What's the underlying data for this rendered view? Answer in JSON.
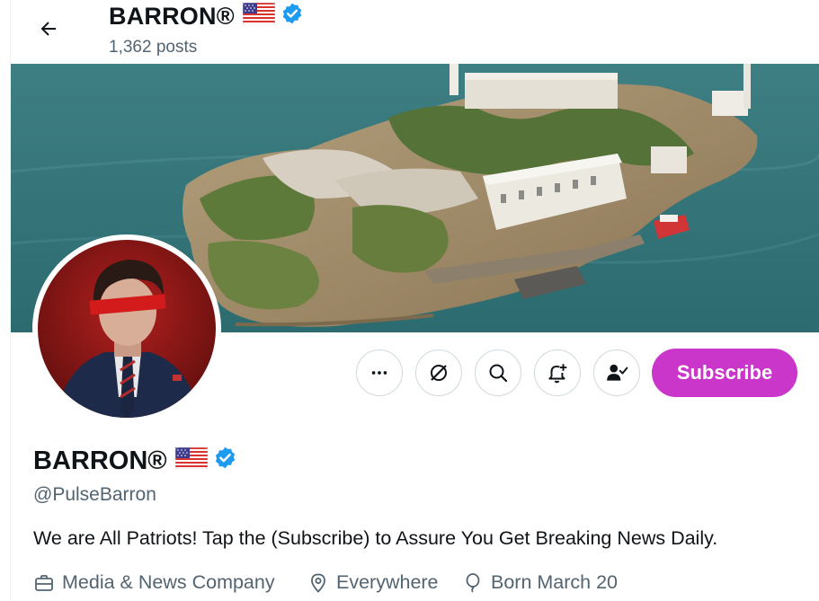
{
  "header": {
    "name": "BARRON®",
    "posts": "1,362 posts"
  },
  "actions": {
    "subscribe_label": "Subscribe",
    "icons": [
      "more-icon",
      "grok-icon",
      "search-icon",
      "notification-add-icon",
      "following-icon"
    ]
  },
  "profile": {
    "name": "BARRON®",
    "handle": "@PulseBarron",
    "bio": "We are All Patriots! Tap the (Subscribe) to Assure You Get Breaking News Daily.",
    "category": "Media & News Company",
    "location": "Everywhere",
    "born": "Born March 20"
  },
  "colors": {
    "subscribe": "#c936c9",
    "verified": "#1d9bf0",
    "muted": "#536471"
  }
}
